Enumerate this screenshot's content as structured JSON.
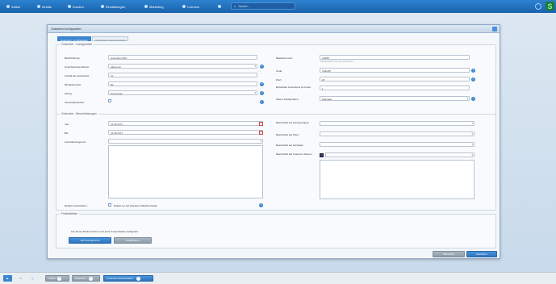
{
  "topnav": [
    {
      "label": "Artikel",
      "icon": "article-icon"
    },
    {
      "label": "Inhalte",
      "icon": "content-icon"
    },
    {
      "label": "Kunden",
      "icon": "customers-icon"
    },
    {
      "label": "Einstellungen",
      "icon": "settings-icon"
    },
    {
      "label": "Marketing",
      "icon": "marketing-icon"
    },
    {
      "label": "Connect",
      "icon": "connect-icon"
    }
  ],
  "search": {
    "placeholder": "Suche..."
  },
  "window": {
    "title": "Gutschein-Konfiguration"
  },
  "tabs": [
    {
      "label": "Gutschein - Konfiguration"
    },
    {
      "label": "Individuelle Gutscheincodes"
    }
  ],
  "config": {
    "legend": "Gutschein - Konfiguration",
    "left": [
      {
        "label": "Beschreibung:",
        "value": "Gutschein 20%"
      },
      {
        "label": "Gutscheincode-Modus:",
        "value": "Allgemein"
      },
      {
        "label": "Anzahl der Gutscheine:",
        "value": "10"
      },
      {
        "label": "Mindestumsatz:",
        "value": "50"
      },
      {
        "label": "Abzug:",
        "value": "Prozentual"
      },
      {
        "label": "Versandkostenfrei:",
        "value": ""
      }
    ],
    "right": [
      {
        "label": "Bestellnummer:",
        "value": "V2089"
      },
      {
        "label": "Code:",
        "value": "V24HR7"
      },
      {
        "label": "Wert:",
        "value": "20"
      },
      {
        "label": "Einlösbare Gutscheine je Kunde:",
        "value": "1"
      },
      {
        "label": "Steuer-Konfiguration:",
        "value": "Standard"
      }
    ],
    "order_hint": "Die Bestellnummer des Gutscheins"
  },
  "restrictions": {
    "legend": "Gutschein - Beschränkungen",
    "von_label": "Von:",
    "von_value": "21.06.2017",
    "bis_label": "Bis:",
    "bis_value": "31.08.2017",
    "artikel_label": "Auf Artikel begrenzt:",
    "rabatt_label": "Rabatt einschränken:",
    "rabatt_text": "Rabatt nur auf teilweise Artikel/Hersteller",
    "kundengruppe_label": "Beschränkt auf Kundengruppe:",
    "shop_label": "Beschränkt auf Shop:",
    "hersteller_label": "Beschränkt auf Hersteller:",
    "customer_label": "Beschränkt auf Customer Stream:"
  },
  "freitext": {
    "legend": "Freitextfelder",
    "text": "Für dieses Modul wurden noch keine Freitextfelder konfiguriert",
    "configure": "Jetzt konfigurieren",
    "disable": "Deaktivieren"
  },
  "footer": {
    "cancel": "Abbrechen",
    "save": "Speichern"
  },
  "taskbar": [
    {
      "label": "Artikel"
    },
    {
      "label": "Gutschein"
    },
    {
      "label": "Gutschein-Administration"
    }
  ]
}
